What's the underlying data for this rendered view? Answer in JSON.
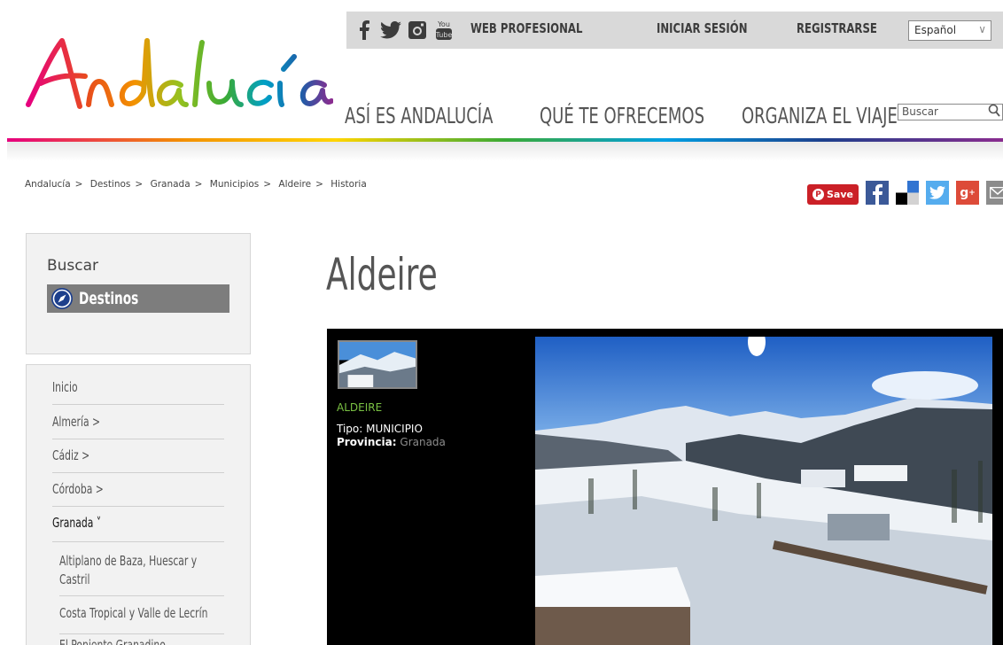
{
  "brand": {
    "logo_text": "Andalucía"
  },
  "topbar": {
    "social_icons": [
      "facebook-icon",
      "twitter-icon",
      "instagram-icon",
      "youtube-icon"
    ],
    "links": [
      "WEB PROFESIONAL",
      "INICIAR SESIÓN",
      "REGISTRARSE"
    ],
    "language": "Español"
  },
  "nav": {
    "items": [
      "ASÍ ES ANDALUCÍA",
      "QUÉ TE OFRECEMOS",
      "ORGANIZA EL VIAJE"
    ],
    "search_placeholder": "Buscar"
  },
  "breadcrumb": [
    "Andalucía",
    "Destinos",
    "Granada",
    "Municipios",
    "Aldeire",
    "Historia"
  ],
  "breadcrumb_sep": ">",
  "share": {
    "save_label": "Save",
    "icons": [
      "pinterest-icon",
      "facebook-icon",
      "delicious-icon",
      "twitter-icon",
      "google-plus-icon",
      "email-icon"
    ]
  },
  "sidebar": {
    "search_title": "Buscar",
    "destinations_label": "Destinos",
    "menu": [
      {
        "label": "Inicio"
      },
      {
        "label": "Almería >"
      },
      {
        "label": "Cádiz >"
      },
      {
        "label": "Córdoba >"
      },
      {
        "label": "Granada ˅"
      }
    ],
    "submenu": [
      {
        "label": "Altiplano de Baza, Huescar y Castril"
      },
      {
        "label": "Costa Tropical y Valle de Lecrín"
      },
      {
        "label": "El Poniente Granadino"
      }
    ]
  },
  "main": {
    "title": "Aldeire",
    "gallery": {
      "name": "ALDEIRE",
      "tipo_label": "Tipo:",
      "tipo_value": "MUNICIPIO",
      "provincia_label": "Provincia:",
      "provincia_value": "Granada"
    }
  },
  "colors": {
    "brand_magenta": "#e6007e",
    "accent_green": "#7ac143",
    "topbar_bg": "#d9d9d9",
    "save_red": "#cb2027"
  }
}
